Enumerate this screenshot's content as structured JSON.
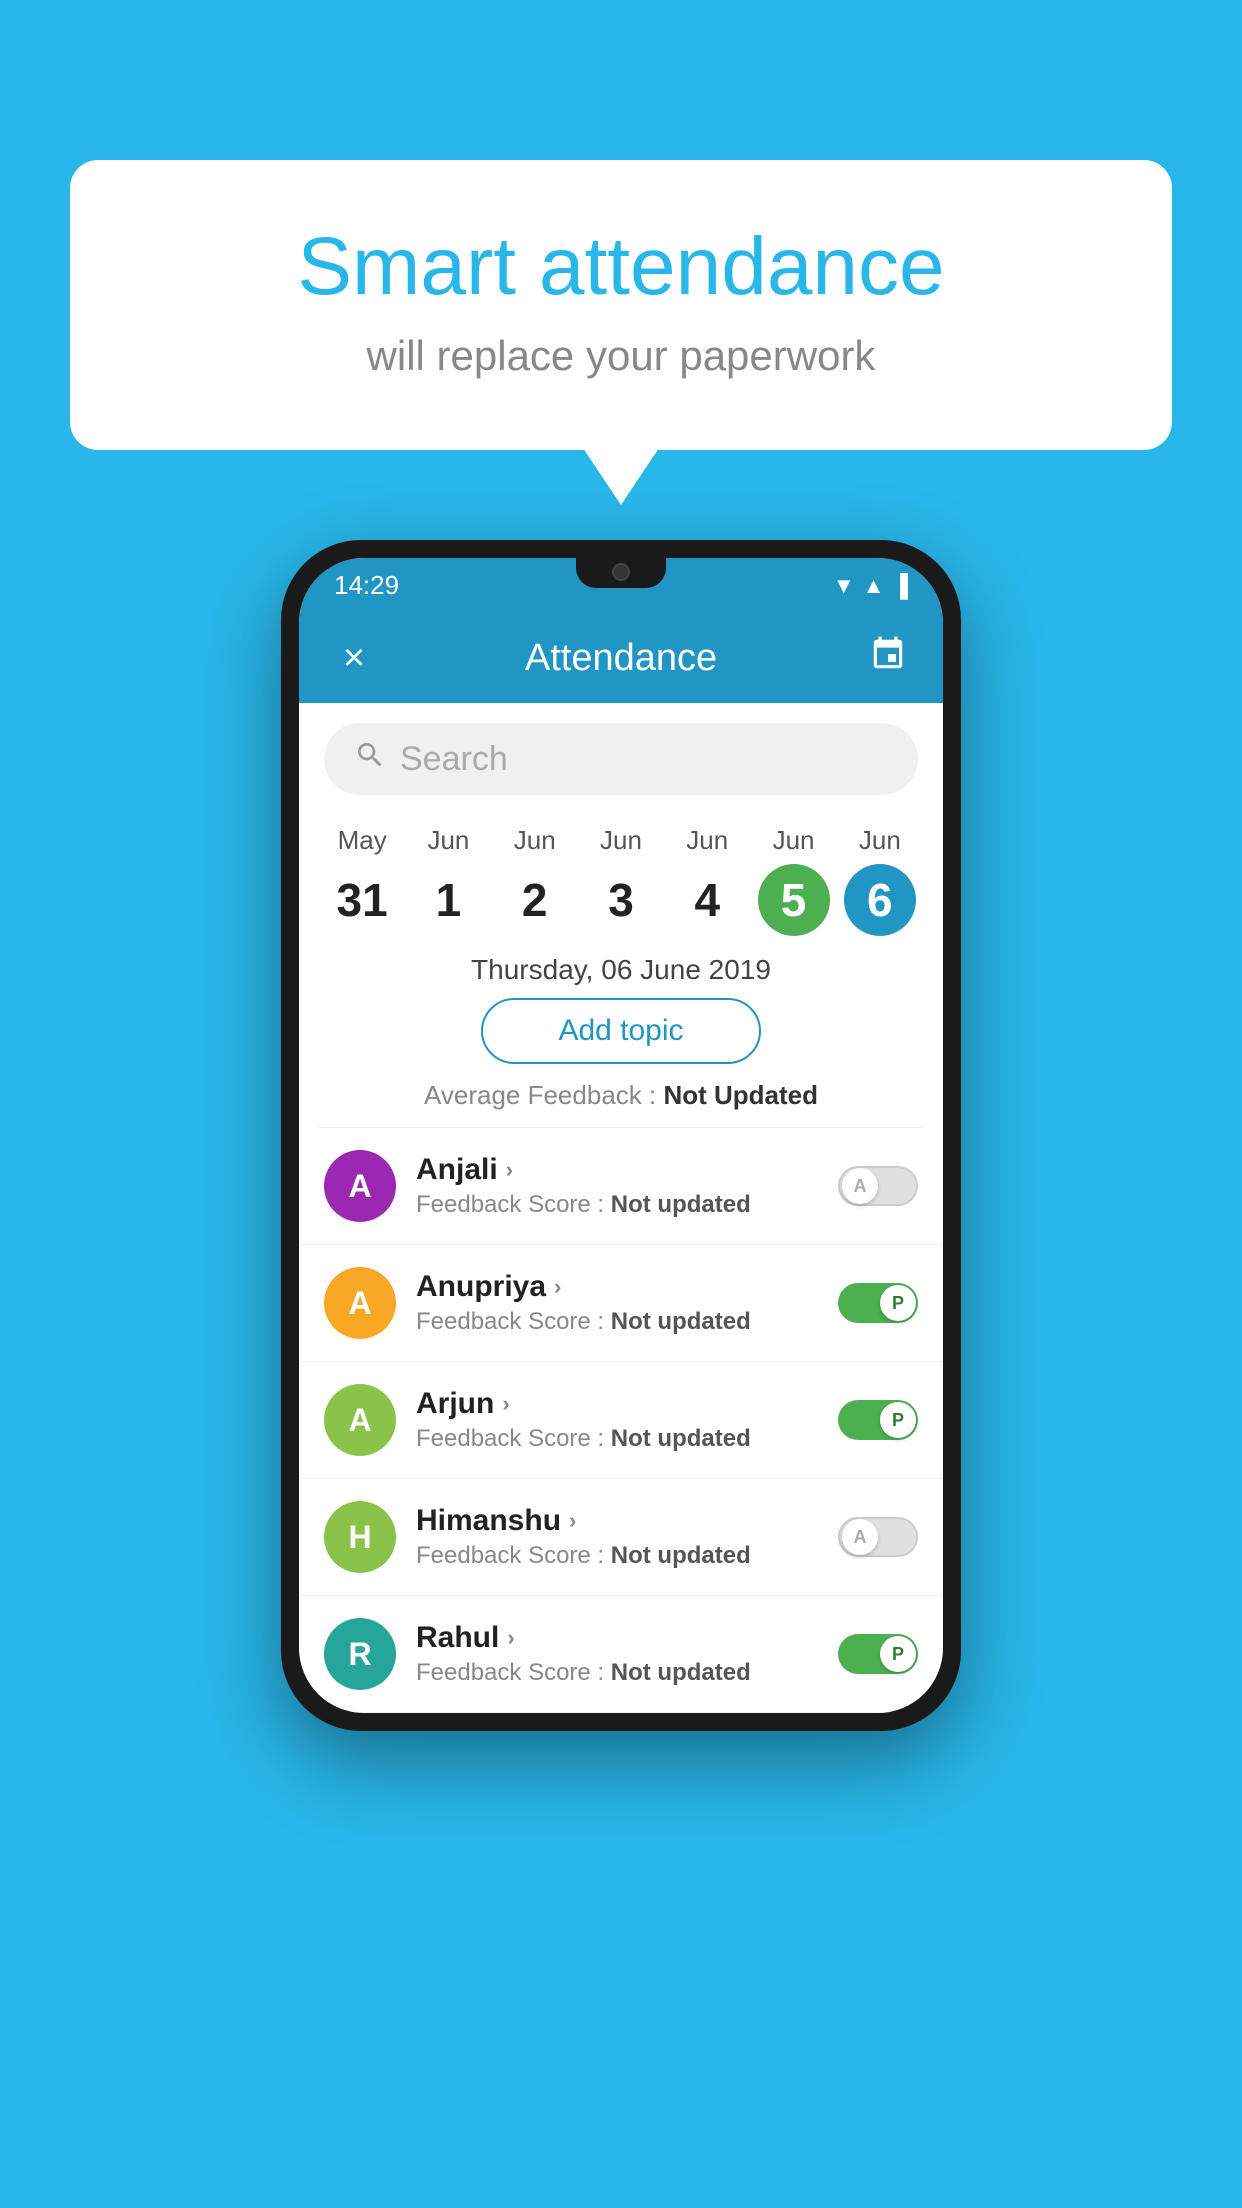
{
  "background": {
    "color": "#29b6e8"
  },
  "hero": {
    "title": "Smart attendance",
    "subtitle": "will replace your paperwork"
  },
  "statusBar": {
    "time": "14:29",
    "wifi_icon": "wifi",
    "signal_icon": "signal",
    "battery_icon": "battery"
  },
  "appBar": {
    "close_label": "×",
    "title": "Attendance",
    "calendar_label": "📅"
  },
  "search": {
    "placeholder": "Search"
  },
  "calendarStrip": {
    "days": [
      {
        "month": "May",
        "date": "31",
        "state": "normal"
      },
      {
        "month": "Jun",
        "date": "1",
        "state": "normal"
      },
      {
        "month": "Jun",
        "date": "2",
        "state": "normal"
      },
      {
        "month": "Jun",
        "date": "3",
        "state": "normal"
      },
      {
        "month": "Jun",
        "date": "4",
        "state": "normal"
      },
      {
        "month": "Jun",
        "date": "5",
        "state": "today"
      },
      {
        "month": "Jun",
        "date": "6",
        "state": "selected"
      }
    ]
  },
  "selectedDate": "Thursday, 06 June 2019",
  "addTopicLabel": "Add topic",
  "averageFeedback": {
    "label": "Average Feedback : ",
    "value": "Not Updated"
  },
  "students": [
    {
      "name": "Anjali",
      "avatarLetter": "A",
      "avatarColor": "#9c27b0",
      "feedbackLabel": "Feedback Score : ",
      "feedbackValue": "Not updated",
      "toggleState": "off",
      "toggleLabel": "A"
    },
    {
      "name": "Anupriya",
      "avatarLetter": "A",
      "avatarColor": "#f9a825",
      "feedbackLabel": "Feedback Score : ",
      "feedbackValue": "Not updated",
      "toggleState": "on",
      "toggleLabel": "P"
    },
    {
      "name": "Arjun",
      "avatarLetter": "A",
      "avatarColor": "#8bc34a",
      "feedbackLabel": "Feedback Score : ",
      "feedbackValue": "Not updated",
      "toggleState": "on",
      "toggleLabel": "P"
    },
    {
      "name": "Himanshu",
      "avatarLetter": "H",
      "avatarColor": "#8bc34a",
      "feedbackLabel": "Feedback Score : ",
      "feedbackValue": "Not updated",
      "toggleState": "off",
      "toggleLabel": "A"
    },
    {
      "name": "Rahul",
      "avatarLetter": "R",
      "avatarColor": "#26a69a",
      "feedbackLabel": "Feedback Score : ",
      "feedbackValue": "Not updated",
      "toggleState": "on",
      "toggleLabel": "P"
    }
  ]
}
